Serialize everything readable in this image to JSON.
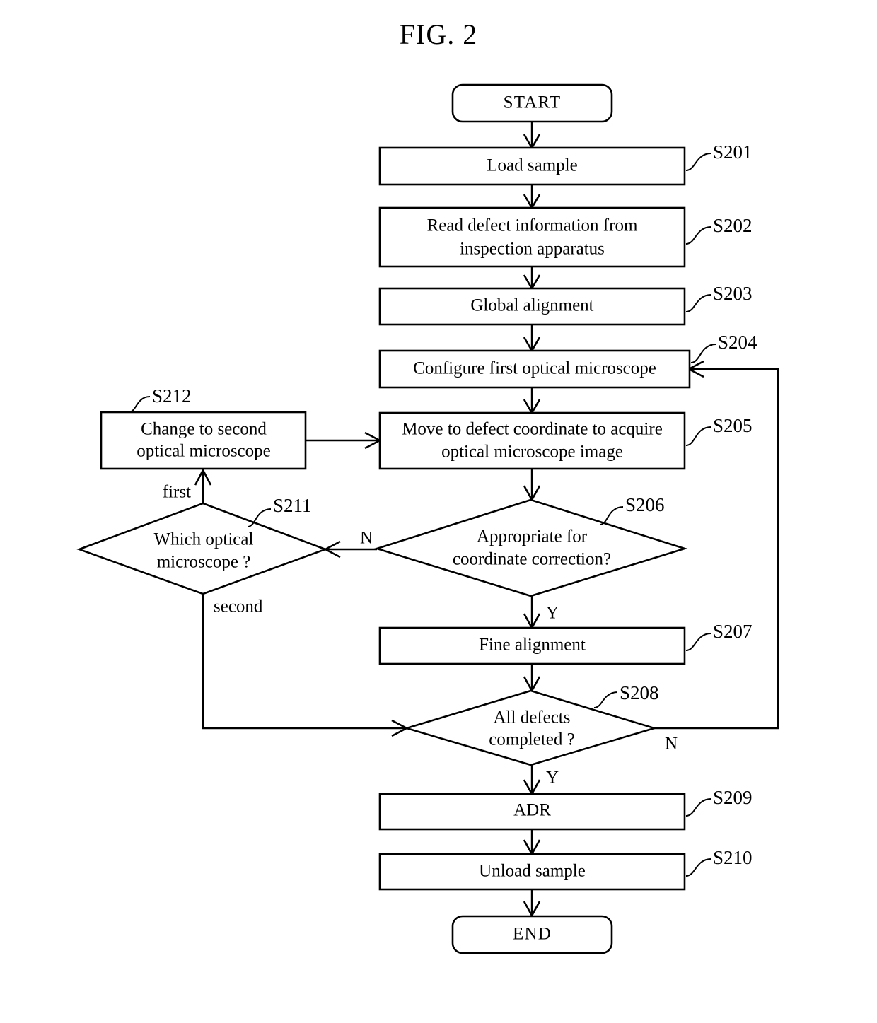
{
  "figure": {
    "title": "FIG. 2",
    "type": "flowchart",
    "domain": "patent-drawing"
  },
  "nodes": [
    {
      "id": "start",
      "kind": "terminal",
      "label": "START",
      "tag": ""
    },
    {
      "id": "s201",
      "kind": "process",
      "label": "Load sample",
      "tag": "S201"
    },
    {
      "id": "s202",
      "kind": "process",
      "label_line1": "Read defect information from",
      "label_line2": "inspection apparatus",
      "tag": "S202"
    },
    {
      "id": "s203",
      "kind": "process",
      "label": "Global alignment",
      "tag": "S203"
    },
    {
      "id": "s204",
      "kind": "process",
      "label": "Configure first optical microscope",
      "tag": "S204"
    },
    {
      "id": "s205",
      "kind": "process",
      "label_line1": "Move to defect coordinate to acquire",
      "label_line2": "optical microscope image",
      "tag": "S205"
    },
    {
      "id": "s206",
      "kind": "decision",
      "label_line1": "Appropriate for",
      "label_line2": "coordinate correction?",
      "tag": "S206"
    },
    {
      "id": "s207",
      "kind": "process",
      "label": "Fine alignment",
      "tag": "S207"
    },
    {
      "id": "s208",
      "kind": "decision",
      "label_line1": "All defects",
      "label_line2": "completed ?",
      "tag": "S208"
    },
    {
      "id": "s209",
      "kind": "process",
      "label": "ADR",
      "tag": "S209"
    },
    {
      "id": "s210",
      "kind": "process",
      "label": "Unload sample",
      "tag": "S210"
    },
    {
      "id": "s211",
      "kind": "decision",
      "label_line1": "Which optical",
      "label_line2": "microscope ?",
      "tag": "S211"
    },
    {
      "id": "s212",
      "kind": "process",
      "label_line1": "Change to second",
      "label_line2": "optical microscope",
      "tag": "S212"
    },
    {
      "id": "end",
      "kind": "terminal",
      "label": "END",
      "tag": ""
    }
  ],
  "edge_labels": {
    "s206_no": "N",
    "s206_yes": "Y",
    "s208_no": "N",
    "s208_yes": "Y",
    "s211_first": "first",
    "s211_second": "second"
  },
  "colors": {
    "stroke": "#000000",
    "fill": "#ffffff",
    "background": "#ffffff"
  }
}
